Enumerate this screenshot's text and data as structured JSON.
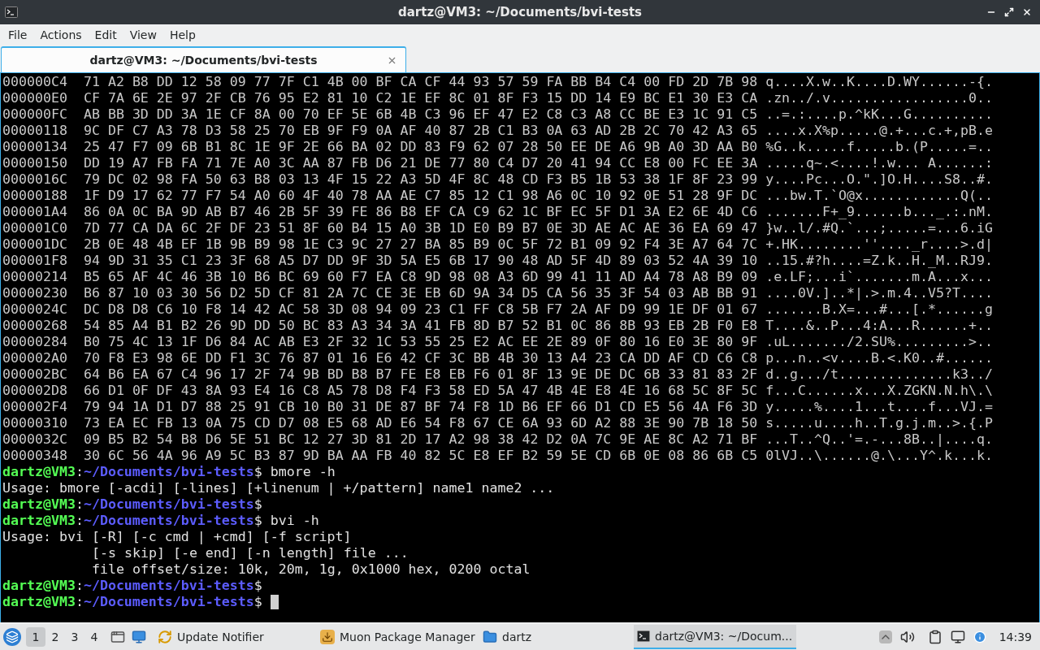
{
  "window": {
    "title": "dartz@VM3: ~/Documents/bvi-tests"
  },
  "menu": [
    "File",
    "Actions",
    "Edit",
    "View",
    "Help"
  ],
  "tabs": [
    {
      "label": "dartz@VM3: ~/Documents/bvi-tests",
      "selected": true
    }
  ],
  "terminal": {
    "lines": [
      {
        "kind": "hex",
        "address": "000000C4",
        "bytes": "71 A2 B8 DD 12 58 09 77 7F C1 4B 00 BF CA CF 44 93 57 59 FA BB B4 C4 00 FD 2D 7B 98",
        "ascii": "q....X.w..K....D.WY......-{."
      },
      {
        "kind": "hex",
        "address": "000000E0",
        "bytes": "CF 7A 6E 2E 97 2F CB 76 95 E2 81 10 C2 1E EF 8C 01 8F F3 15 DD 14 E9 BC E1 30 E3 CA",
        "ascii": ".zn../.v.................0.."
      },
      {
        "kind": "hex",
        "address": "000000FC",
        "bytes": "AB BB 3D DD 3A 1E CF 8A 00 70 EF 5E 6B 4B C3 96 EF 47 E2 C8 C3 A8 CC BE E3 1C 91 C5",
        "ascii": "..=.:....p.^kK...G.........."
      },
      {
        "kind": "hex",
        "address": "00000118",
        "bytes": "9C DF C7 A3 78 D3 58 25 70 EB 9F F9 0A AF 40 87 2B C1 B3 0A 63 AD 2B 2C 70 42 A3 65",
        "ascii": "....x.X%p.....@.+...c.+,pB.e"
      },
      {
        "kind": "hex",
        "address": "00000134",
        "bytes": "25 47 F7 09 6B B1 8C 1E 9F 2E 66 BA 02 DD 83 F9 62 07 28 50 EE DE A6 9B A0 3D AA B0",
        "ascii": "%G..k.....f.....b.(P.....=.."
      },
      {
        "kind": "hex",
        "address": "00000150",
        "bytes": "DD 19 A7 FB FA 71 7E A0 3C AA 87 FB D6 21 DE 77 80 C4 D7 20 41 94 CC E8 00 FC EE 3A",
        "ascii": ".....q~.<....!.w... A......:"
      },
      {
        "kind": "hex",
        "address": "0000016C",
        "bytes": "79 DC 02 98 FA 50 63 B8 03 13 4F 15 22 A3 5D 4F 8C 48 CD F3 B5 1B 53 38 1F 8F 23 99",
        "ascii": "y....Pc...O.\".]O.H....S8..#."
      },
      {
        "kind": "hex",
        "address": "00000188",
        "bytes": "1F D9 17 62 77 F7 54 A0 60 4F 40 78 AA AE C7 85 12 C1 98 A6 0C 10 92 0E 51 28 9F DC",
        "ascii": "...bw.T.`O@x............Q(.."
      },
      {
        "kind": "hex",
        "address": "000001A4",
        "bytes": "86 0A 0C BA 9D AB B7 46 2B 5F 39 FE 86 B8 EF CA C9 62 1C BF EC 5F D1 3A E2 6E 4D C6",
        "ascii": ".......F+_9......b..._.:.nM."
      },
      {
        "kind": "hex",
        "address": "000001C0",
        "bytes": "7D 77 CA DA 6C 2F DF 23 51 8F 60 B4 15 A0 3B 1D E0 B9 B7 0E 3D AE AC AE 36 EA 69 47",
        "ascii": "}w..l/.#Q.`...;.....=...6.iG"
      },
      {
        "kind": "hex",
        "address": "000001DC",
        "bytes": "2B 0E 48 4B EF 1B 9B B9 98 1E C3 9C 27 27 BA 85 B9 0C 5F 72 B1 09 92 F4 3E A7 64 7C",
        "ascii": "+.HK........''...._r....>.d|"
      },
      {
        "kind": "hex",
        "address": "000001F8",
        "bytes": "94 9D 31 35 C1 23 3F 68 A5 D7 DD 9F 3D 5A E5 6B 17 90 48 AD 5F 4D 89 03 52 4A 39 10",
        "ascii": "..15.#?h....=Z.k..H._M..RJ9."
      },
      {
        "kind": "hex",
        "address": "00000214",
        "bytes": "B5 65 AF 4C 46 3B 10 B6 BC 69 60 F7 EA C8 9D 98 08 A3 6D 99 41 11 AD A4 78 A8 B9 09",
        "ascii": ".e.LF;...i`.......m.A...x..."
      },
      {
        "kind": "hex",
        "address": "00000230",
        "bytes": "B6 87 10 03 30 56 D2 5D CF 81 2A 7C CE 3E EB 6D 9A 34 D5 CA 56 35 3F 54 03 AB BB 91",
        "ascii": "....0V.]..*|.>.m.4..V5?T...."
      },
      {
        "kind": "hex",
        "address": "0000024C",
        "bytes": "DC D8 D8 C6 10 F8 14 42 AC 58 3D 08 94 09 23 C1 FF C8 5B F7 2A AF D9 99 1E DF 01 67",
        "ascii": ".......B.X=...#...[.*......g"
      },
      {
        "kind": "hex",
        "address": "00000268",
        "bytes": "54 85 A4 B1 B2 26 9D DD 50 BC 83 A3 34 3A 41 FB 8D B7 52 B1 0C 86 8B 93 EB 2B F0 E8",
        "ascii": "T....&..P...4:A...R......+.."
      },
      {
        "kind": "hex",
        "address": "00000284",
        "bytes": "B0 75 4C 13 1F D6 84 AC AB E3 2F 32 1C 53 55 25 E2 AC EE 2E 89 0F 80 16 E0 3E 80 9F",
        "ascii": ".uL......./2.SU%.........>.."
      },
      {
        "kind": "hex",
        "address": "000002A0",
        "bytes": "70 F8 E3 98 6E DD F1 3C 76 87 01 16 E6 42 CF 3C BB 4B 30 13 A4 23 CA DD AF CD C6 C8",
        "ascii": "p...n..<v....B.<.K0..#......"
      },
      {
        "kind": "hex",
        "address": "000002BC",
        "bytes": "64 B6 EA 67 C4 96 17 2F 74 9B BD B8 B7 FE E8 EB F6 01 8F 13 9E DE DC 6B 33 81 83 2F",
        "ascii": "d..g.../t..............k3../"
      },
      {
        "kind": "hex",
        "address": "000002D8",
        "bytes": "66 D1 0F DF 43 8A 93 E4 16 C8 A5 78 D8 F4 F3 58 ED 5A 47 4B 4E E8 4E 16 68 5C 8F 5C",
        "ascii": "f...C......x...X.ZGKN.N.h\\.\\"
      },
      {
        "kind": "hex",
        "address": "000002F4",
        "bytes": "79 94 1A D1 D7 88 25 91 CB 10 B0 31 DE 87 BF 74 F8 1D B6 EF 66 D1 CD E5 56 4A F6 3D",
        "ascii": "y.....%....1...t....f...VJ.="
      },
      {
        "kind": "hex",
        "address": "00000310",
        "bytes": "73 EA EC FB 13 0A 75 CD D7 08 E5 68 AD E6 54 F8 67 CE 6A 93 6D A2 88 3E 90 7B 18 50",
        "ascii": "s.....u....h..T.g.j.m..>.{.P"
      },
      {
        "kind": "hex",
        "address": "0000032C",
        "bytes": "09 B5 B2 54 B8 D6 5E 51 BC 12 27 3D 81 2D 17 A2 98 38 42 D2 0A 7C 9E AE 8C A2 71 BF",
        "ascii": "...T..^Q..'=.-...8B..|....q."
      },
      {
        "kind": "hex",
        "address": "00000348",
        "bytes": "30 6C 56 4A 96 A9 5C B3 87 9D BA AA FB 40 82 5C E8 EF B2 59 5E CD 6B 0E 08 86 6B C5",
        "ascii": "0lVJ..\\......@.\\...Y^.k...k."
      },
      {
        "kind": "prompt",
        "user": "dartz@VM3",
        "separator": ":",
        "path": "~/Documents/bvi-tests",
        "symbol": "$",
        "command": "bmore -h"
      },
      {
        "kind": "output",
        "text": "Usage: bmore [-acdi] [-lines] [+linenum | +/pattern] name1 name2 ..."
      },
      {
        "kind": "prompt",
        "user": "dartz@VM3",
        "separator": ":",
        "path": "~/Documents/bvi-tests",
        "symbol": "$"
      },
      {
        "kind": "prompt",
        "user": "dartz@VM3",
        "separator": ":",
        "path": "~/Documents/bvi-tests",
        "symbol": "$",
        "command": "bvi -h"
      },
      {
        "kind": "output",
        "text": "Usage: bvi [-R] [-c cmd | +cmd] [-f script]"
      },
      {
        "kind": "continuation",
        "text": "[-s skip] [-e end] [-n length] file ..."
      },
      {
        "kind": "continuation",
        "text": "file offset/size: 10k, 20m, 1g, 0x1000 hex, 0200 octal"
      },
      {
        "kind": "prompt",
        "user": "dartz@VM3",
        "separator": ":",
        "path": "~/Documents/bvi-tests",
        "symbol": "$"
      },
      {
        "kind": "prompt",
        "user": "dartz@VM3",
        "separator": ":",
        "path": "~/Documents/bvi-tests",
        "symbol": "$",
        "cursor": true
      }
    ]
  },
  "taskbar": {
    "desktops": [
      {
        "label": "1",
        "selected": true
      },
      {
        "label": "2",
        "selected": false
      },
      {
        "label": "3",
        "selected": false
      },
      {
        "label": "4",
        "selected": false
      }
    ],
    "tasks": [
      {
        "kind": "notifier",
        "label": "Update Notifier",
        "selected": false
      },
      {
        "kind": "package",
        "label": "Muon Package Manager",
        "selected": false
      },
      {
        "kind": "folder",
        "label": "dartz",
        "selected": false
      },
      {
        "kind": "terminal",
        "label": "dartz@VM3: ~/Docum...",
        "selected": true
      }
    ],
    "clock": "14:39"
  }
}
